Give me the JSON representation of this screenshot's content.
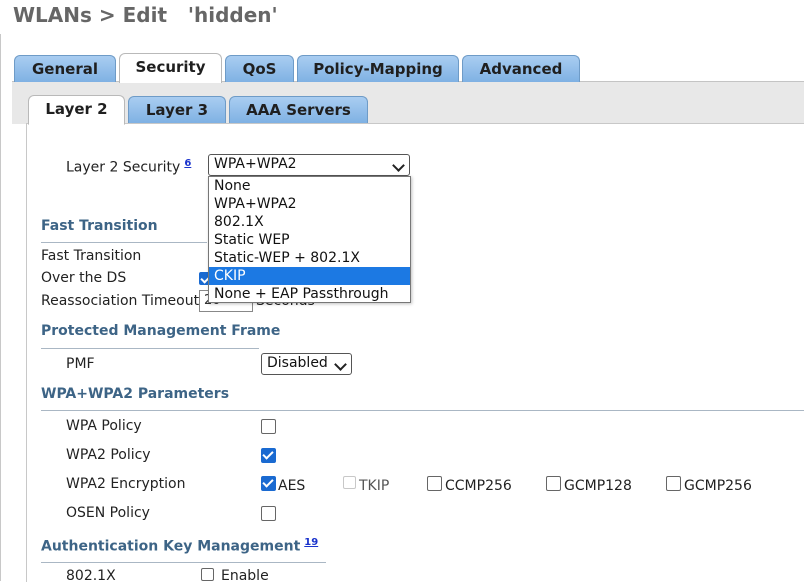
{
  "page": {
    "title": "WLANs > Edit   'hidden'"
  },
  "main_tabs": [
    {
      "label": "General",
      "active": false
    },
    {
      "label": "Security",
      "active": true
    },
    {
      "label": "QoS",
      "active": false
    },
    {
      "label": "Policy-Mapping",
      "active": false
    },
    {
      "label": "Advanced",
      "active": false
    }
  ],
  "sub_tabs": [
    {
      "label": "Layer 2",
      "active": true
    },
    {
      "label": "Layer 3",
      "active": false
    },
    {
      "label": "AAA Servers",
      "active": false
    }
  ],
  "layer2_security": {
    "label": "Layer 2 Security",
    "footnote": "6",
    "selected": "WPA+WPA2",
    "options": [
      "None",
      "WPA+WPA2",
      "802.1X",
      "Static WEP",
      "Static-WEP + 802.1X",
      "CKIP",
      "None + EAP Passthrough"
    ],
    "highlighted": "CKIP"
  },
  "fast_transition": {
    "heading": "Fast Transition",
    "fast_transition_label": "Fast Transition",
    "over_ds_label": "Over the DS",
    "reassoc_label": "Reassociation Timeout",
    "reassoc_value": "20",
    "reassoc_unit": "Seconds"
  },
  "pmf": {
    "heading": "Protected Management Frame",
    "label": "PMF",
    "value": "Disabled"
  },
  "wpa_params": {
    "heading": "WPA+WPA2 Parameters",
    "wpa_policy_label": "WPA Policy",
    "wpa2_policy_label": "WPA2 Policy",
    "wpa2_encryption_label": "WPA2 Encryption",
    "osen_policy_label": "OSEN Policy",
    "enc_options": [
      {
        "label": "AES",
        "checked": true,
        "disabled": false
      },
      {
        "label": "TKIP",
        "checked": false,
        "disabled": true
      },
      {
        "label": "CCMP256",
        "checked": false,
        "disabled": false
      },
      {
        "label": "GCMP128",
        "checked": false,
        "disabled": false
      },
      {
        "label": "GCMP256",
        "checked": false,
        "disabled": false
      }
    ]
  },
  "akm": {
    "heading": "Authentication Key Management",
    "footnote": "19",
    "row1_label": "802.1X",
    "row1_enable": "Enable"
  },
  "colors": {
    "tab_bg": "#7fb1e3",
    "section_heading": "#3d6486",
    "selected_option": "#1c79e3",
    "checkbox_on": "#1a6ad1"
  }
}
